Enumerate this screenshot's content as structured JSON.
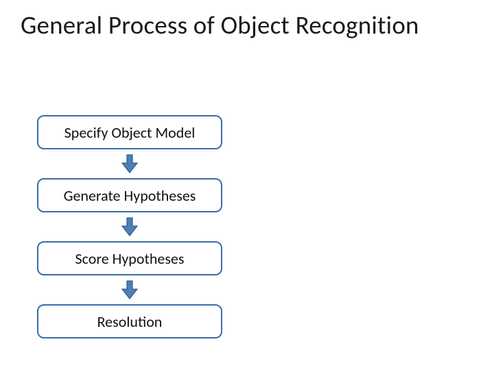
{
  "title": "General Process of Object Recognition",
  "steps": [
    {
      "label": "Specify Object Model"
    },
    {
      "label": "Generate Hypotheses"
    },
    {
      "label": "Score Hypotheses"
    },
    {
      "label": "Resolution"
    }
  ],
  "colors": {
    "box_border": "#3b6ca8",
    "arrow_fill": "#4f7eb3",
    "arrow_edge": "#2f5b91"
  }
}
